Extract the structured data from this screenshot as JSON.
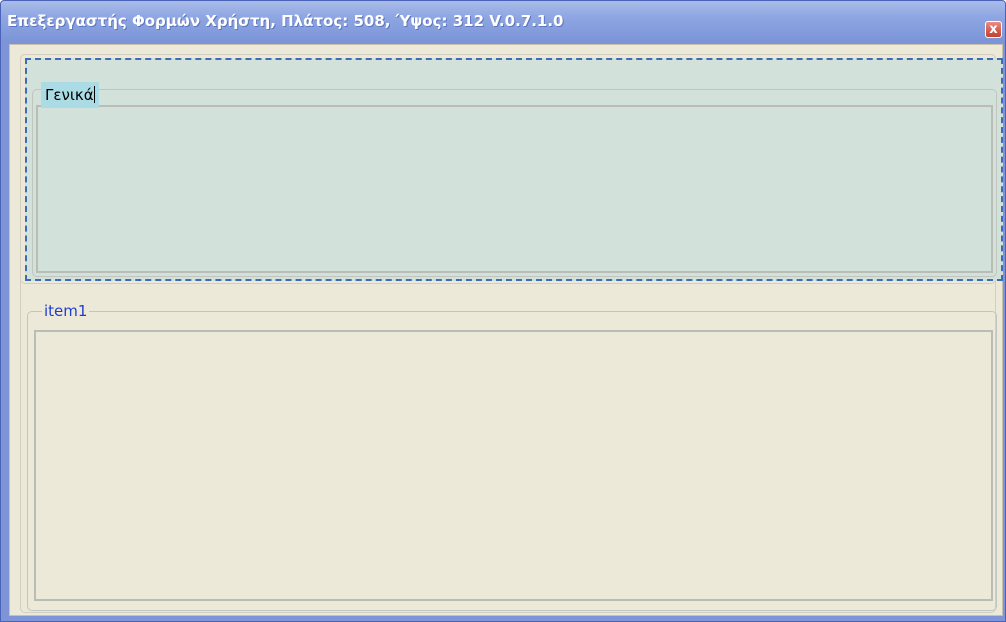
{
  "window": {
    "title": "Επεξεργαστής Φορμών Χρήστη, Πλάτος: 508, Ύψος: 312 V.0.7.1.0",
    "close_label": "x"
  },
  "groups": [
    {
      "label": "Γενικά",
      "selected": true
    },
    {
      "label": "item1",
      "selected": false
    }
  ],
  "colors": {
    "titlebar": "#8ea6e2",
    "client": "#ede9d9",
    "selected_fill": "#d2e1da",
    "selected_border": "#3f6bb4",
    "legend_highlight": "#abdbe4",
    "legend_text": "#1f3fd0",
    "close_button": "#d35a4b"
  },
  "icons": {
    "close": "close-icon"
  }
}
